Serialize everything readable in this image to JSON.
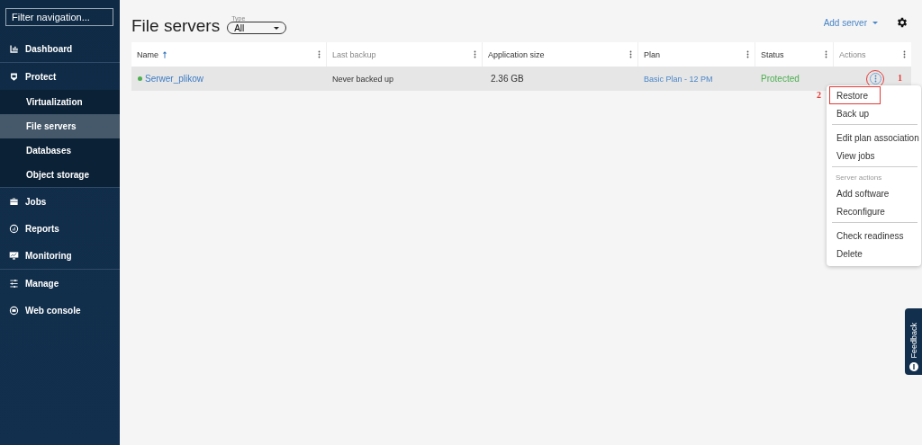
{
  "sidebar": {
    "filter": {
      "placeholder": "Filter navigation..."
    },
    "groups": [
      {
        "items": [
          {
            "label": "Dashboard",
            "kind": "section",
            "selected": false
          }
        ]
      },
      {
        "items": [
          {
            "label": "Protect",
            "kind": "section",
            "selected": false
          },
          {
            "label": "Virtualization",
            "kind": "sub",
            "selected": false
          },
          {
            "label": "File servers",
            "kind": "sub",
            "selected": true
          },
          {
            "label": "Databases",
            "kind": "sub",
            "selected": false
          },
          {
            "label": "Object storage",
            "kind": "sub",
            "selected": false
          }
        ]
      },
      {
        "items": [
          {
            "label": "Jobs",
            "kind": "section",
            "selected": false
          },
          {
            "label": "Reports",
            "kind": "section",
            "selected": false
          },
          {
            "label": "Monitoring",
            "kind": "section",
            "selected": false
          }
        ]
      },
      {
        "items": [
          {
            "label": "Manage",
            "kind": "section",
            "selected": false
          },
          {
            "label": "Web console",
            "kind": "section",
            "selected": false
          }
        ]
      }
    ]
  },
  "page": {
    "title": "File servers",
    "type_filter": {
      "label": "Type",
      "value": "All"
    },
    "add_button": "Add server"
  },
  "table": {
    "columns": [
      {
        "label": "Name",
        "sorted": true,
        "muted": false
      },
      {
        "label": "Last backup",
        "sorted": false,
        "muted": true
      },
      {
        "label": "Application size",
        "sorted": false,
        "muted": false
      },
      {
        "label": "Plan",
        "sorted": false,
        "muted": false
      },
      {
        "label": "Status",
        "sorted": false,
        "muted": false
      },
      {
        "label": "Actions",
        "sorted": false,
        "muted": true
      }
    ],
    "rows": [
      {
        "name": "Serwer_plikow",
        "color": "#4caf50",
        "last_backup": "Never backed up",
        "size": "2.36 GB",
        "plan": "Basic Plan - 12 PM",
        "status": "Protected"
      }
    ]
  },
  "actions_menu": {
    "items": [
      {
        "kind": "item",
        "label": "Restore",
        "highlighted": true
      },
      {
        "kind": "item",
        "label": "Back up",
        "highlighted": false
      },
      {
        "kind": "divider"
      },
      {
        "kind": "item",
        "label": "Edit plan association",
        "highlighted": false
      },
      {
        "kind": "item",
        "label": "View jobs",
        "highlighted": false
      },
      {
        "kind": "divider"
      },
      {
        "kind": "header",
        "label": "Server actions"
      },
      {
        "kind": "item",
        "label": "Add software",
        "highlighted": false
      },
      {
        "kind": "item",
        "label": "Reconfigure",
        "highlighted": false
      },
      {
        "kind": "divider"
      },
      {
        "kind": "item",
        "label": "Check readiness",
        "highlighted": false
      },
      {
        "kind": "item",
        "label": "Delete",
        "highlighted": false
      }
    ]
  },
  "annotations": {
    "step_1": "1",
    "step_2": "2"
  },
  "feedback_tab": "Feedback"
}
